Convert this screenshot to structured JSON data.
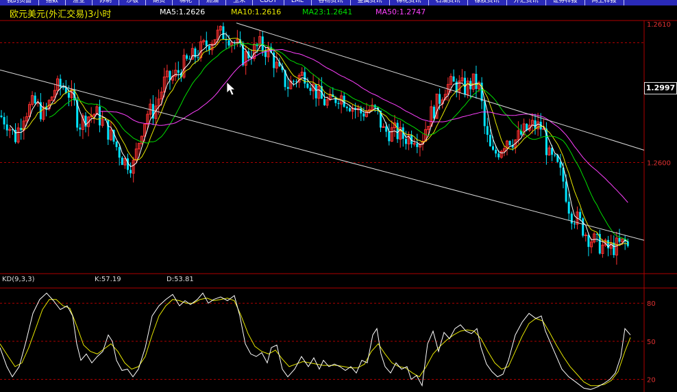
{
  "tabs": [
    "我的页面",
    "指数",
    "渔业",
    "苏制",
    "沙板",
    "期货",
    "棉花",
    "燃油",
    "玉米",
    "CBOT",
    "LME",
    "谷物资讯",
    "金属资讯",
    "棉花资讯",
    "石油资讯",
    "橡胶资讯",
    "外汇资讯",
    "证券样报",
    "网上样报"
  ],
  "header": {
    "title": "欧元美元(外汇交易)3小时",
    "ma5": "MA5:1.2626",
    "ma10": "MA10:1.2616",
    "ma23": "MA23:1.2641",
    "ma50": "MA50:1.2747"
  },
  "kd": {
    "label": "KD(9,3,3)",
    "k": "K:57.19",
    "d": "D:53.81"
  },
  "current_price": "1.2997",
  "colors": {
    "up": "#ff3030",
    "down": "#00e5ff",
    "ma5": "#ffffff",
    "ma10": "#e8e800",
    "ma23": "#00e000",
    "ma50": "#ff40ff",
    "grid": "#b00000",
    "k_line": "#ffffff",
    "d_line": "#e8e800"
  },
  "chart_data": [
    {
      "type": "candlestick",
      "title": "欧元美元(外汇交易)3小时",
      "y_ticks": [
        "1.2610",
        "1.2600"
      ],
      "main_path": [
        [
          0,
          1.2638
        ],
        [
          10,
          1.2633
        ],
        [
          22,
          1.262
        ],
        [
          35,
          1.264
        ],
        [
          50,
          1.2648
        ],
        [
          65,
          1.2638
        ],
        [
          80,
          1.266
        ],
        [
          95,
          1.2662
        ],
        [
          108,
          1.2648
        ],
        [
          115,
          1.263
        ],
        [
          125,
          1.2637
        ],
        [
          140,
          1.264
        ],
        [
          155,
          1.2628
        ],
        [
          168,
          1.2615
        ],
        [
          180,
          1.2602
        ],
        [
          195,
          1.2598
        ],
        [
          207,
          1.2628
        ],
        [
          215,
          1.264
        ],
        [
          225,
          1.2642
        ],
        [
          240,
          1.2665
        ],
        [
          255,
          1.267
        ],
        [
          270,
          1.268
        ],
        [
          285,
          1.2687
        ],
        [
          300,
          1.2695
        ],
        [
          315,
          1.2703
        ],
        [
          330,
          1.2705
        ],
        [
          345,
          1.2695
        ],
        [
          355,
          1.2685
        ],
        [
          368,
          1.269
        ],
        [
          380,
          1.2695
        ],
        [
          395,
          1.2688
        ],
        [
          408,
          1.2672
        ],
        [
          420,
          1.2662
        ],
        [
          432,
          1.2668
        ],
        [
          445,
          1.2672
        ],
        [
          458,
          1.266
        ],
        [
          470,
          1.265
        ],
        [
          482,
          1.2648
        ],
        [
          495,
          1.2655
        ],
        [
          510,
          1.2648
        ],
        [
          525,
          1.264
        ],
        [
          540,
          1.2643
        ],
        [
          550,
          1.264
        ],
        [
          560,
          1.2625
        ],
        [
          575,
          1.2625
        ],
        [
          590,
          1.262
        ],
        [
          605,
          1.2622
        ],
        [
          615,
          1.2618
        ],
        [
          625,
          1.2635
        ],
        [
          640,
          1.265
        ],
        [
          650,
          1.2662
        ],
        [
          665,
          1.2663
        ],
        [
          680,
          1.266
        ],
        [
          690,
          1.2665
        ],
        [
          700,
          1.266
        ],
        [
          708,
          1.2625
        ],
        [
          718,
          1.2605
        ],
        [
          728,
          1.261
        ],
        [
          740,
          1.262
        ],
        [
          752,
          1.2618
        ],
        [
          765,
          1.2625
        ],
        [
          778,
          1.263
        ],
        [
          792,
          1.2628
        ],
        [
          800,
          1.2605
        ],
        [
          812,
          1.2598
        ],
        [
          822,
          1.2585
        ],
        [
          832,
          1.256
        ],
        [
          845,
          1.2552
        ],
        [
          858,
          1.254
        ],
        [
          870,
          1.2535
        ],
        [
          885,
          1.253
        ],
        [
          900,
          1.2532
        ],
        [
          912,
          1.2535
        ],
        [
          920,
          1.2528
        ]
      ],
      "ma_params": {
        "ma5": 4,
        "ma10": 8,
        "ma23": 18,
        "ma50": 36
      },
      "y_range": [
        1.251,
        1.2715
      ]
    },
    {
      "type": "line",
      "title": "KD(9,3,3)",
      "y_ticks": [
        80,
        50,
        20
      ],
      "y_range": [
        10,
        92
      ],
      "k_points": [
        [
          0,
          45
        ],
        [
          10,
          30
        ],
        [
          18,
          22
        ],
        [
          28,
          30
        ],
        [
          38,
          50
        ],
        [
          48,
          72
        ],
        [
          58,
          83
        ],
        [
          68,
          88
        ],
        [
          78,
          82
        ],
        [
          88,
          75
        ],
        [
          98,
          78
        ],
        [
          106,
          70
        ],
        [
          112,
          48
        ],
        [
          118,
          35
        ],
        [
          126,
          40
        ],
        [
          134,
          33
        ],
        [
          142,
          38
        ],
        [
          150,
          42
        ],
        [
          158,
          55
        ],
        [
          164,
          50
        ],
        [
          170,
          35
        ],
        [
          178,
          27
        ],
        [
          186,
          28
        ],
        [
          194,
          22
        ],
        [
          202,
          28
        ],
        [
          212,
          45
        ],
        [
          222,
          70
        ],
        [
          232,
          78
        ],
        [
          242,
          83
        ],
        [
          252,
          87
        ],
        [
          262,
          78
        ],
        [
          270,
          82
        ],
        [
          278,
          79
        ],
        [
          288,
          83
        ],
        [
          296,
          88
        ],
        [
          304,
          80
        ],
        [
          312,
          83
        ],
        [
          322,
          85
        ],
        [
          332,
          82
        ],
        [
          342,
          86
        ],
        [
          350,
          70
        ],
        [
          358,
          48
        ],
        [
          366,
          40
        ],
        [
          374,
          38
        ],
        [
          382,
          41
        ],
        [
          390,
          33
        ],
        [
          396,
          45
        ],
        [
          404,
          47
        ],
        [
          412,
          28
        ],
        [
          420,
          22
        ],
        [
          430,
          28
        ],
        [
          440,
          38
        ],
        [
          450,
          30
        ],
        [
          458,
          37
        ],
        [
          466,
          28
        ],
        [
          472,
          35
        ],
        [
          480,
          30
        ],
        [
          488,
          32
        ],
        [
          496,
          30
        ],
        [
          504,
          27
        ],
        [
          512,
          30
        ],
        [
          520,
          25
        ],
        [
          528,
          35
        ],
        [
          536,
          33
        ],
        [
          544,
          55
        ],
        [
          550,
          60
        ],
        [
          556,
          40
        ],
        [
          562,
          30
        ],
        [
          570,
          25
        ],
        [
          578,
          33
        ],
        [
          586,
          28
        ],
        [
          594,
          30
        ],
        [
          600,
          20
        ],
        [
          608,
          23
        ],
        [
          616,
          15
        ],
        [
          624,
          48
        ],
        [
          632,
          58
        ],
        [
          640,
          42
        ],
        [
          648,
          57
        ],
        [
          656,
          52
        ],
        [
          664,
          60
        ],
        [
          672,
          63
        ],
        [
          680,
          58
        ],
        [
          688,
          56
        ],
        [
          696,
          60
        ],
        [
          702,
          45
        ],
        [
          710,
          32
        ],
        [
          718,
          26
        ],
        [
          726,
          22
        ],
        [
          734,
          24
        ],
        [
          742,
          35
        ],
        [
          752,
          55
        ],
        [
          762,
          65
        ],
        [
          772,
          72
        ],
        [
          782,
          68
        ],
        [
          790,
          70
        ],
        [
          796,
          58
        ],
        [
          804,
          48
        ],
        [
          812,
          38
        ],
        [
          820,
          28
        ],
        [
          830,
          22
        ],
        [
          840,
          18
        ],
        [
          852,
          13
        ],
        [
          862,
          12
        ],
        [
          872,
          14
        ],
        [
          882,
          17
        ],
        [
          890,
          20
        ],
        [
          898,
          25
        ],
        [
          906,
          38
        ],
        [
          912,
          60
        ],
        [
          920,
          55
        ]
      ],
      "d_points": [
        [
          0,
          48
        ],
        [
          12,
          38
        ],
        [
          22,
          30
        ],
        [
          32,
          33
        ],
        [
          42,
          45
        ],
        [
          52,
          60
        ],
        [
          62,
          75
        ],
        [
          72,
          83
        ],
        [
          82,
          83
        ],
        [
          92,
          78
        ],
        [
          102,
          76
        ],
        [
          112,
          62
        ],
        [
          122,
          47
        ],
        [
          132,
          42
        ],
        [
          142,
          40
        ],
        [
          152,
          44
        ],
        [
          162,
          48
        ],
        [
          172,
          42
        ],
        [
          182,
          33
        ],
        [
          192,
          28
        ],
        [
          202,
          30
        ],
        [
          212,
          38
        ],
        [
          222,
          55
        ],
        [
          232,
          70
        ],
        [
          242,
          78
        ],
        [
          252,
          83
        ],
        [
          262,
          82
        ],
        [
          272,
          80
        ],
        [
          282,
          80
        ],
        [
          292,
          83
        ],
        [
          302,
          84
        ],
        [
          312,
          82
        ],
        [
          322,
          83
        ],
        [
          332,
          84
        ],
        [
          342,
          82
        ],
        [
          352,
          70
        ],
        [
          362,
          56
        ],
        [
          372,
          46
        ],
        [
          382,
          42
        ],
        [
          392,
          40
        ],
        [
          402,
          43
        ],
        [
          412,
          36
        ],
        [
          422,
          30
        ],
        [
          432,
          32
        ],
        [
          442,
          34
        ],
        [
          452,
          33
        ],
        [
          462,
          32
        ],
        [
          472,
          31
        ],
        [
          482,
          31
        ],
        [
          492,
          31
        ],
        [
          502,
          30
        ],
        [
          512,
          29
        ],
        [
          522,
          29
        ],
        [
          532,
          32
        ],
        [
          542,
          42
        ],
        [
          552,
          48
        ],
        [
          562,
          40
        ],
        [
          572,
          33
        ],
        [
          582,
          30
        ],
        [
          592,
          29
        ],
        [
          602,
          25
        ],
        [
          612,
          22
        ],
        [
          622,
          30
        ],
        [
          632,
          40
        ],
        [
          642,
          46
        ],
        [
          652,
          51
        ],
        [
          662,
          55
        ],
        [
          672,
          58
        ],
        [
          682,
          59
        ],
        [
          692,
          58
        ],
        [
          702,
          52
        ],
        [
          712,
          42
        ],
        [
          722,
          33
        ],
        [
          732,
          28
        ],
        [
          742,
          30
        ],
        [
          752,
          42
        ],
        [
          762,
          54
        ],
        [
          772,
          64
        ],
        [
          782,
          68
        ],
        [
          792,
          66
        ],
        [
          802,
          57
        ],
        [
          812,
          47
        ],
        [
          822,
          38
        ],
        [
          832,
          30
        ],
        [
          842,
          24
        ],
        [
          852,
          18
        ],
        [
          862,
          15
        ],
        [
          872,
          15
        ],
        [
          882,
          16
        ],
        [
          892,
          19
        ],
        [
          902,
          26
        ],
        [
          912,
          42
        ],
        [
          920,
          53
        ]
      ]
    }
  ]
}
